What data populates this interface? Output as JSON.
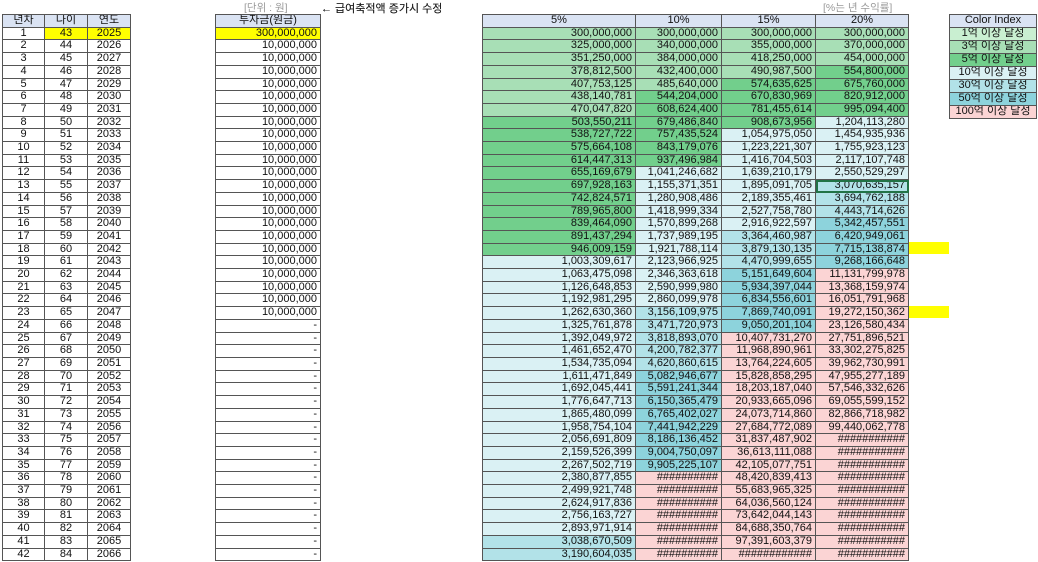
{
  "left_table": {
    "headers": [
      "년차",
      "나이",
      "연도"
    ]
  },
  "invest_table": {
    "unit_note": "[단위 : 원]",
    "header": "투자금(원금)",
    "values": [
      "300,000,000",
      "10,000,000",
      "10,000,000",
      "10,000,000",
      "10,000,000",
      "10,000,000",
      "10,000,000",
      "10,000,000",
      "10,000,000",
      "10,000,000",
      "10,000,000",
      "10,000,000",
      "10,000,000",
      "10,000,000",
      "10,000,000",
      "10,000,000",
      "10,000,000",
      "10,000,000",
      "10,000,000",
      "10,000,000",
      "10,000,000",
      "10,000,000",
      "10,000,000",
      "-",
      "-",
      "-",
      "-",
      "-",
      "-",
      "-",
      "-",
      "-",
      "-",
      "-",
      "-",
      "-",
      "-",
      "-",
      "-",
      "-",
      "-",
      "-"
    ],
    "notes": [
      {
        "row": 6,
        "text": "← 급여축적액 증가시 수정"
      },
      {
        "row": 11,
        "text": "← 급여축적액 증가시 수정"
      }
    ]
  },
  "returns_table": {
    "unit_note": "[%는 년 수익률]",
    "headers": [
      "5%",
      "10%",
      "15%",
      "20%"
    ],
    "col5": [
      "300,000,000",
      "325,000,000",
      "351,250,000",
      "378,812,500",
      "407,753,125",
      "438,140,781",
      "470,047,820",
      "503,550,211",
      "538,727,722",
      "575,664,108",
      "614,447,313",
      "655,169,679",
      "697,928,163",
      "742,824,571",
      "789,965,800",
      "839,464,090",
      "891,437,294",
      "946,009,159",
      "1,003,309,617",
      "1,063,475,098",
      "1,126,648,853",
      "1,192,981,295",
      "1,262,630,360",
      "1,325,761,878",
      "1,392,049,972",
      "1,461,652,470",
      "1,534,735,094",
      "1,611,471,849",
      "1,692,045,441",
      "1,776,647,713",
      "1,865,480,099",
      "1,958,754,104",
      "2,056,691,809",
      "2,159,526,399",
      "2,267,502,719",
      "2,380,877,855",
      "2,499,921,748",
      "2,624,917,836",
      "2,756,163,727",
      "2,893,971,914",
      "3,038,670,509",
      "3,190,604,035"
    ],
    "col10": [
      "300,000,000",
      "340,000,000",
      "384,000,000",
      "432,400,000",
      "485,640,000",
      "544,204,000",
      "608,624,400",
      "679,486,840",
      "757,435,524",
      "843,179,076",
      "937,496,984",
      "1,041,246,682",
      "1,155,371,351",
      "1,280,908,486",
      "1,418,999,334",
      "1,570,899,268",
      "1,737,989,195",
      "1,921,788,114",
      "2,123,966,925",
      "2,346,363,618",
      "2,590,999,980",
      "2,860,099,978",
      "3,156,109,975",
      "3,471,720,973",
      "3,818,893,070",
      "4,200,782,377",
      "4,620,860,615",
      "5,082,946,677",
      "5,591,241,344",
      "6,150,365,479",
      "6,765,402,027",
      "7,441,942,229",
      "8,186,136,452",
      "9,004,750,097",
      "9,905,225,107",
      "##########",
      "##########",
      "##########",
      "##########",
      "##########",
      "##########",
      "##########"
    ],
    "col15": [
      "300,000,000",
      "355,000,000",
      "418,250,000",
      "490,987,500",
      "574,635,625",
      "670,830,969",
      "781,455,614",
      "908,673,956",
      "1,054,975,050",
      "1,223,221,307",
      "1,416,704,503",
      "1,639,210,179",
      "1,895,091,705",
      "2,189,355,461",
      "2,527,758,780",
      "2,916,922,597",
      "3,364,460,987",
      "3,879,130,135",
      "4,470,999,655",
      "5,151,649,604",
      "5,934,397,044",
      "6,834,556,601",
      "7,869,740,091",
      "9,050,201,104",
      "10,407,731,270",
      "11,968,890,961",
      "13,764,224,605",
      "15,828,858,295",
      "18,203,187,040",
      "20,933,665,096",
      "24,073,714,860",
      "27,684,772,089",
      "31,837,487,902",
      "36,613,111,088",
      "42,105,077,751",
      "48,420,839,413",
      "55,683,965,325",
      "64,036,560,124",
      "73,642,044,143",
      "84,688,350,764",
      "97,391,603,379",
      "############"
    ],
    "col20": [
      "300,000,000",
      "370,000,000",
      "454,000,000",
      "554,800,000",
      "675,760,000",
      "820,912,000",
      "995,094,400",
      "1,204,113,280",
      "1,454,935,936",
      "1,755,923,123",
      "2,117,107,748",
      "2,550,529,297",
      "3,070,635,157",
      "3,694,762,188",
      "4,443,714,626",
      "5,342,457,551",
      "6,420,949,061",
      "7,715,138,874",
      "9,268,166,648",
      "11,131,799,978",
      "13,368,159,974",
      "16,051,791,968",
      "19,272,150,362",
      "23,126,580,434",
      "27,751,896,521",
      "33,302,275,825",
      "39,962,730,991",
      "47,955,277,189",
      "57,546,332,626",
      "69,055,599,152",
      "82,866,718,982",
      "99,440,062,778",
      "###########",
      "###########",
      "###########",
      "###########",
      "###########",
      "###########",
      "###########",
      "###########",
      "###########",
      "###########"
    ]
  },
  "legend": {
    "title": "Color Index",
    "items": [
      {
        "label": "1억 이상 달성",
        "color": "#c9efd1",
        "min": 100000000
      },
      {
        "label": "3억 이상 달성",
        "color": "#a8dfb6",
        "min": 300000000
      },
      {
        "label": "5억 이상 달성",
        "color": "#72cf8c",
        "min": 500000000
      },
      {
        "label": "10억 이상 달성",
        "color": "#daf1f4",
        "min": 1000000000
      },
      {
        "label": "30억 이상 달성",
        "color": "#b2e2e8",
        "min": 3000000000
      },
      {
        "label": "50억 이상 달성",
        "color": "#8dd3dc",
        "min": 5000000000
      },
      {
        "label": "100억 이상 달성",
        "color": "#fbd4d4",
        "min": 10000000000
      }
    ]
  },
  "start": {
    "age": 43,
    "year": 2025,
    "rows": 42
  },
  "highlight_color": "#ffff00"
}
